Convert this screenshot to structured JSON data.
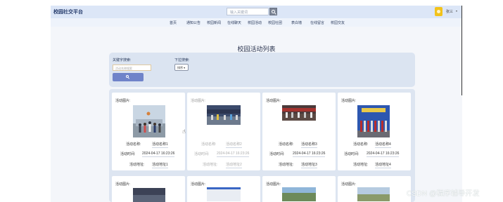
{
  "header": {
    "brand": "校园社交平台",
    "search_placeholder": "输入关键词",
    "user_name": "张三",
    "caret": "▾"
  },
  "nav": {
    "items": [
      "首页",
      "通知公告",
      "校园新闻",
      "在线聊天",
      "校园活动",
      "校园社团",
      "表白墙",
      "在线留言",
      "校园交友"
    ]
  },
  "page_title": "校园活动列表",
  "filter": {
    "keyword_label": "关键字搜索:",
    "keyword_placeholder": "活动名称搜索",
    "pulldown_label": "下拉搜索:",
    "select_value": "排序",
    "select_caret": "▾"
  },
  "cards": [
    {
      "img_label": "活动图片:",
      "name_label": "活动名称:",
      "name": "活动名称1",
      "time_label": "活动时间:",
      "time": "2024-04-17 16:23:26",
      "addr_label": "活动地址:",
      "addr": "活动地址1"
    },
    {
      "img_label": "活动图片:",
      "name_label": "活动名称:",
      "name": "活动名称2",
      "time_label": "活动时间:",
      "time": "2024-04-17 16:23:26",
      "addr_label": "活动地址:",
      "addr": "活动地址2"
    },
    {
      "img_label": "活动图片:",
      "name_label": "活动名称:",
      "name": "活动名称3",
      "time_label": "活动时间:",
      "time": "2024-04-17 16:23:26",
      "addr_label": "活动地址:",
      "addr": "活动地址3"
    },
    {
      "img_label": "活动图片:",
      "name_label": "活动名称:",
      "name": "活动名称4",
      "time_label": "活动时间:",
      "time": "2024-04-17 16:23:26",
      "addr_label": "活动地址:",
      "addr": "活动地址4"
    }
  ],
  "cards_row2": [
    {
      "img_label": "活动图片:"
    },
    {
      "img_label": "活动图片:"
    },
    {
      "img_label": "活动图片:"
    },
    {
      "img_label": "活动图片:"
    }
  ],
  "watermark": "CSDN @程序辅导开发"
}
